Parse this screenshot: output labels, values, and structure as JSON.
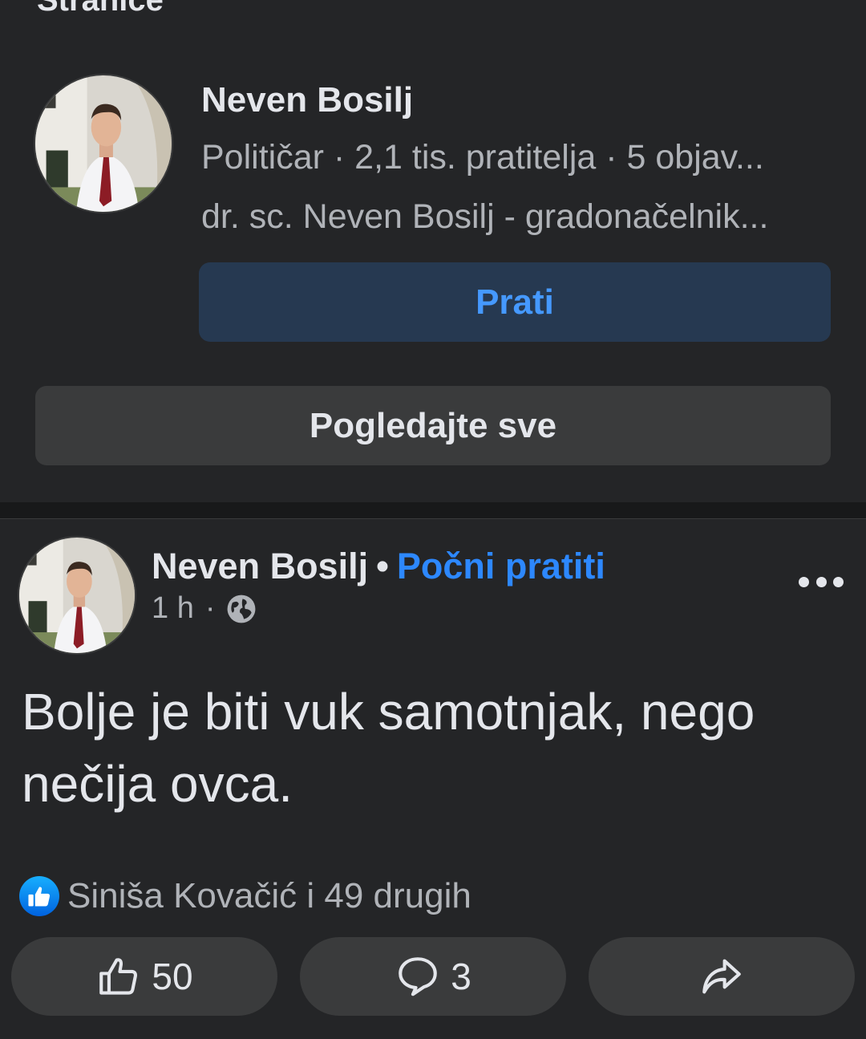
{
  "section": {
    "title": "Stranice"
  },
  "page_card": {
    "name": "Neven Bosilj",
    "meta": "Političar · 2,1 tis. pratitelja · 5 objav...",
    "description": "dr. sc. Neven Bosilj - gradonačelnik...",
    "follow_label": "Prati",
    "see_all_label": "Pogledajte sve"
  },
  "post": {
    "author": "Neven Bosilj",
    "separator": "•",
    "follow_label": "Počni pratiti",
    "time": "1 h",
    "time_sep": "·",
    "audience_icon": "globe-icon",
    "text": "Bolje je biti vuk samotnjak, nego nečija ovca.",
    "reaction_summary": "Siniša Kovačić i 49 drugih",
    "like_count": "50",
    "comment_count": "3",
    "share_label": ""
  },
  "colors": {
    "background": "#242527",
    "divider": "#18191a",
    "button": "#3a3b3c",
    "follow_button_bg": "#263951",
    "accent_blue": "#2d88ff",
    "text_primary": "#e4e6eb",
    "text_secondary": "#b0b3b8"
  }
}
